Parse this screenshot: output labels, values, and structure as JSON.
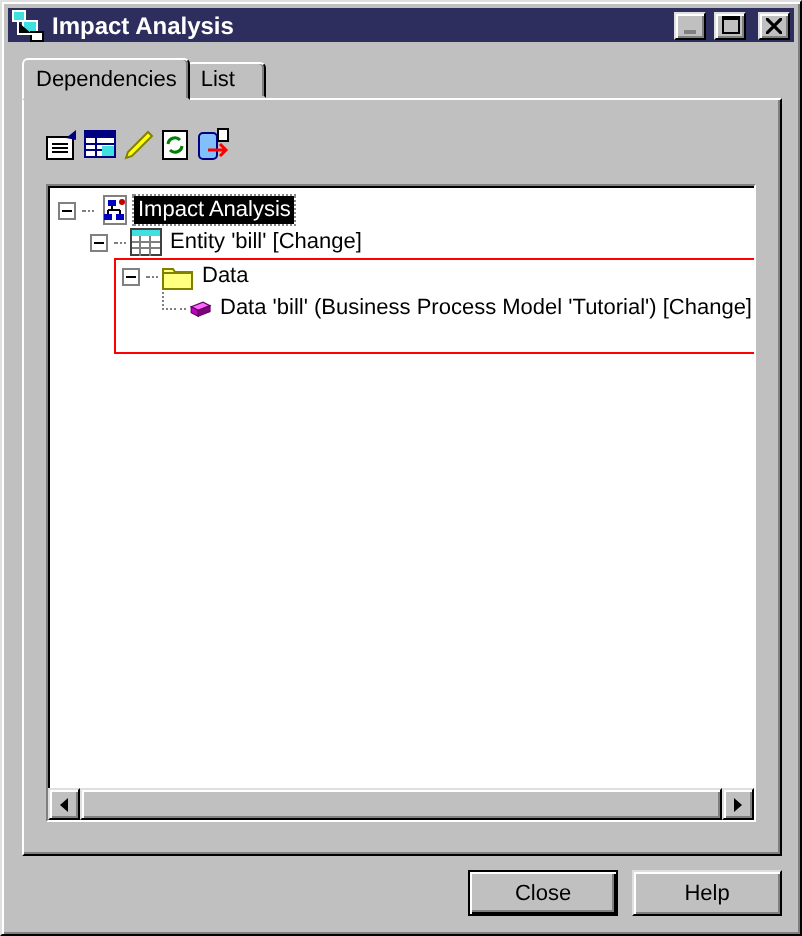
{
  "window": {
    "title": "Impact Analysis"
  },
  "tabs": [
    {
      "label": "Dependencies",
      "selected": true
    },
    {
      "label": "List",
      "selected": false
    }
  ],
  "tree": [
    {
      "label": "Impact Analysis",
      "kind": "root",
      "expanded": true,
      "selected": true,
      "children": [
        {
          "label": "Entity 'bill' [Change]",
          "kind": "entity",
          "expanded": true,
          "selected": false,
          "children": [
            {
              "label": "Data",
              "kind": "folder",
              "expanded": true,
              "selected": false,
              "highlighted": true,
              "children": [
                {
                  "label": "Data 'bill' (Business Process Model 'Tutorial') [Change]",
                  "kind": "data",
                  "selected": false
                }
              ]
            }
          ]
        }
      ]
    }
  ],
  "buttons": [
    {
      "label": "Close",
      "default": true
    },
    {
      "label": "Help",
      "default": false
    }
  ]
}
